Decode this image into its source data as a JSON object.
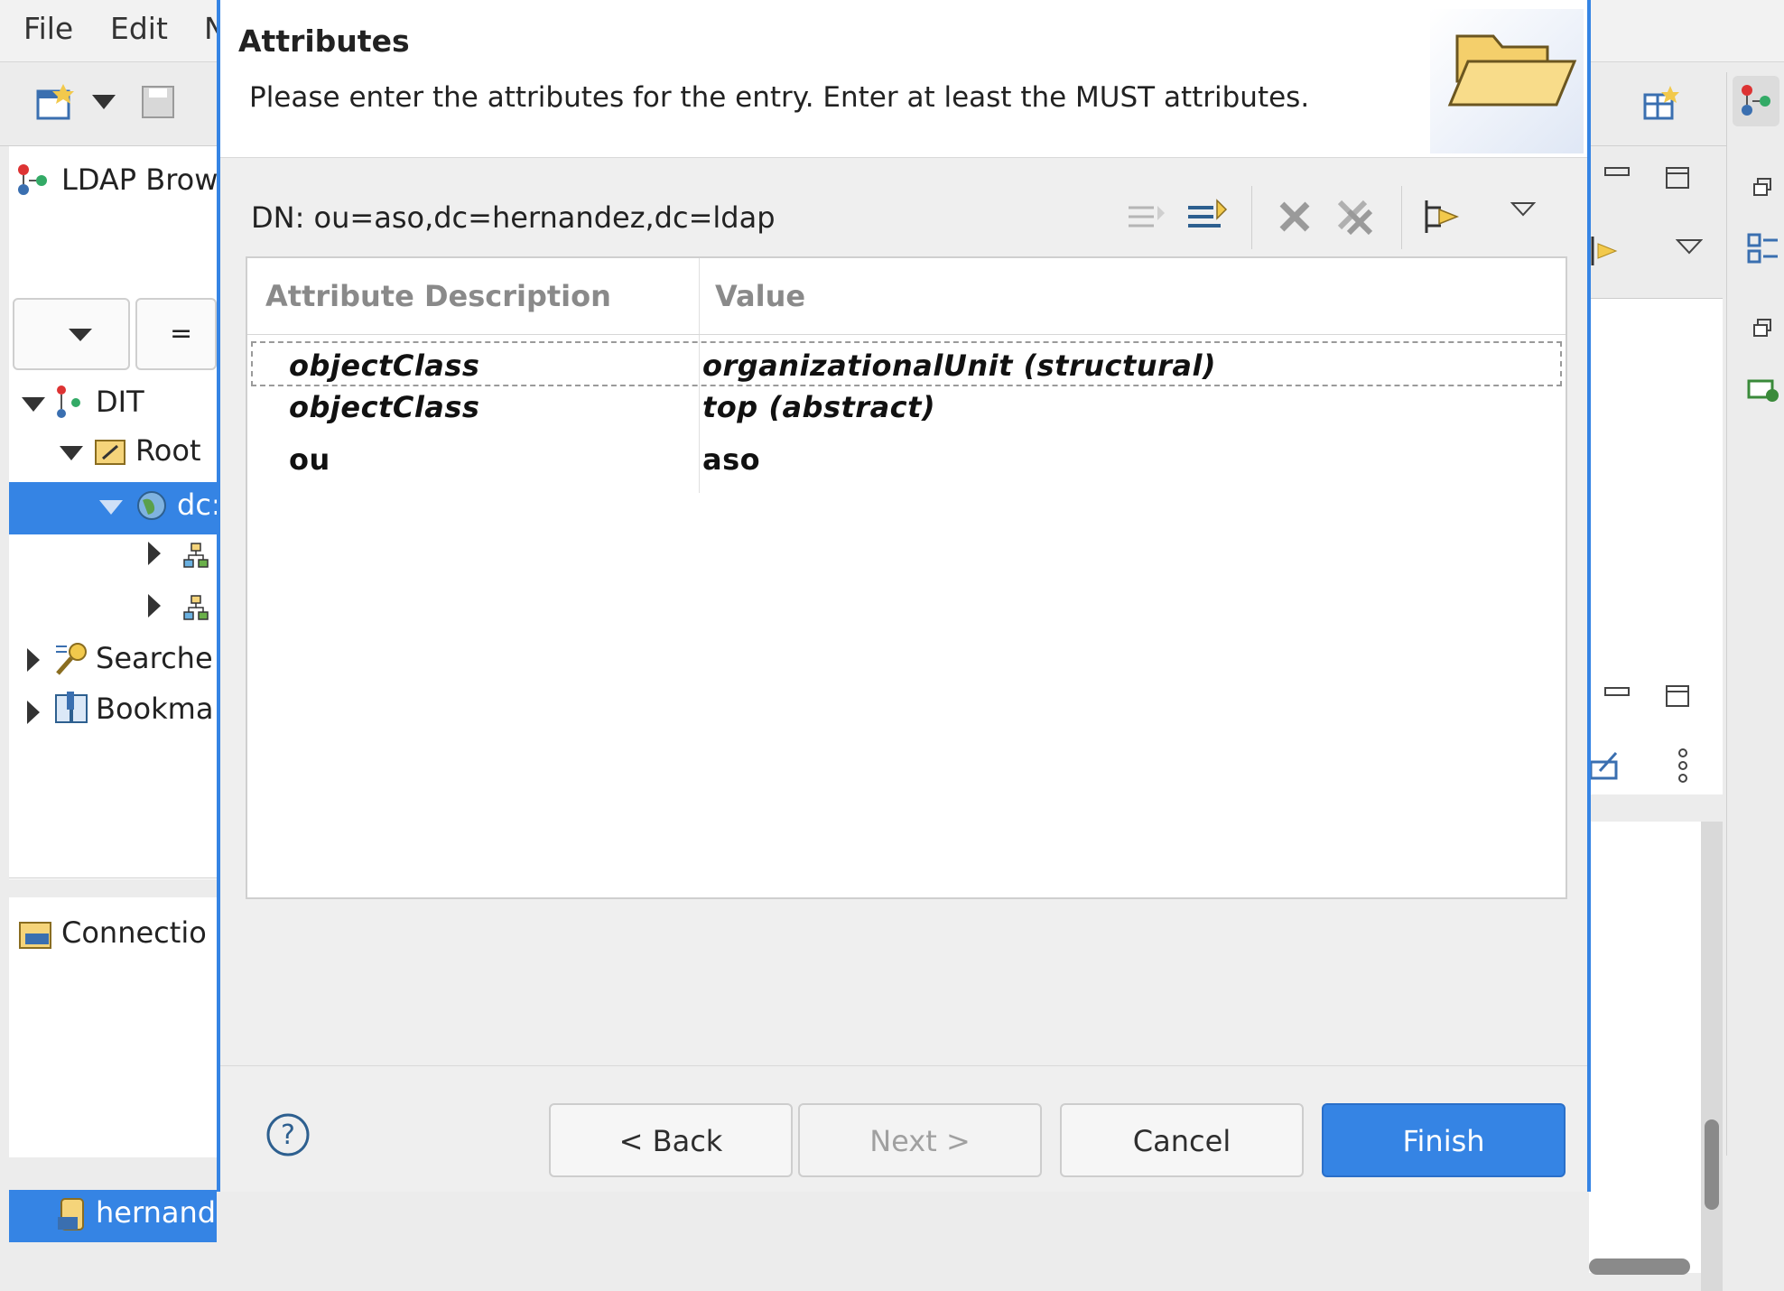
{
  "menu": {
    "file": "File",
    "edit": "Edit",
    "more": "N"
  },
  "ldap_browser": {
    "view_title": "LDAP Brow",
    "filter_operator": "=",
    "tree": {
      "dit": "DIT",
      "root": "Root",
      "dc": "dc:",
      "searches": "Searche",
      "bookmarks": "Bookma"
    }
  },
  "connections": {
    "view_title": "Connectio",
    "selected": "hernand"
  },
  "dialog": {
    "title": "Attributes",
    "description": "Please enter the attributes for the entry. Enter at least the MUST attributes.",
    "dn": "DN: ou=aso,dc=hernandez,dc=ldap",
    "table": {
      "columns": [
        "Attribute Description",
        "Value"
      ],
      "rows": [
        {
          "attribute": "objectClass",
          "value": "organizationalUnit (structural)"
        },
        {
          "attribute": "objectClass",
          "value": "top (abstract)"
        },
        {
          "attribute": "ou",
          "value": "aso"
        }
      ]
    },
    "buttons": {
      "help": "?",
      "back": "< Back",
      "next": "Next >",
      "cancel": "Cancel",
      "finish": "Finish"
    }
  },
  "colors": {
    "accent": "#3584e4",
    "selection": "#3584e4"
  }
}
